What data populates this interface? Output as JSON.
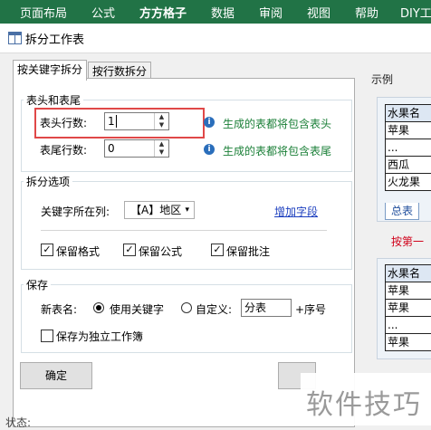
{
  "ribbon": {
    "tabs": [
      "页面布局",
      "公式",
      "方方格子",
      "数据",
      "审阅",
      "视图",
      "帮助",
      "DIY工"
    ],
    "active": "方方格子"
  },
  "window": {
    "title": "拆分工作表"
  },
  "tabs": [
    "按关键字拆分",
    "按行数拆分"
  ],
  "header_footer": {
    "group_title": "表头和表尾",
    "header_label": "表头行数:",
    "header_value": "1",
    "header_hint": "生成的表都将包含表头",
    "footer_label": "表尾行数:",
    "footer_value": "0",
    "footer_hint": "生成的表都将包含表尾"
  },
  "split_options": {
    "group_title": "拆分选项",
    "keyword_col_label": "关键字所在列:",
    "keyword_col_value": "【A】地区",
    "add_field_link": "增加字段",
    "checkboxes": [
      "保留格式",
      "保留公式",
      "保留批注"
    ]
  },
  "save": {
    "group_title": "保存",
    "new_name_label": "新表名:",
    "radio_keyword": "使用关键字",
    "radio_custom": "自定义:",
    "custom_value": "分表",
    "suffix": "+序号",
    "independent_label": "保存为独立工作簿"
  },
  "buttons": {
    "ok": "确定"
  },
  "status": "状态:",
  "example": {
    "title": "示例",
    "table1": [
      "水果名",
      "苹果",
      "...",
      "西瓜",
      "火龙果"
    ],
    "sheet_tab": "总表",
    "arrow_text": "按第一",
    "table2": [
      "水果名",
      "苹果",
      "苹果",
      "...",
      "苹果"
    ]
  },
  "watermark": "软件技巧",
  "colors": {
    "ribbon": "#217346",
    "hint": "#1a7f37",
    "highlight": "#e04848",
    "link": "#1c3fbf"
  }
}
